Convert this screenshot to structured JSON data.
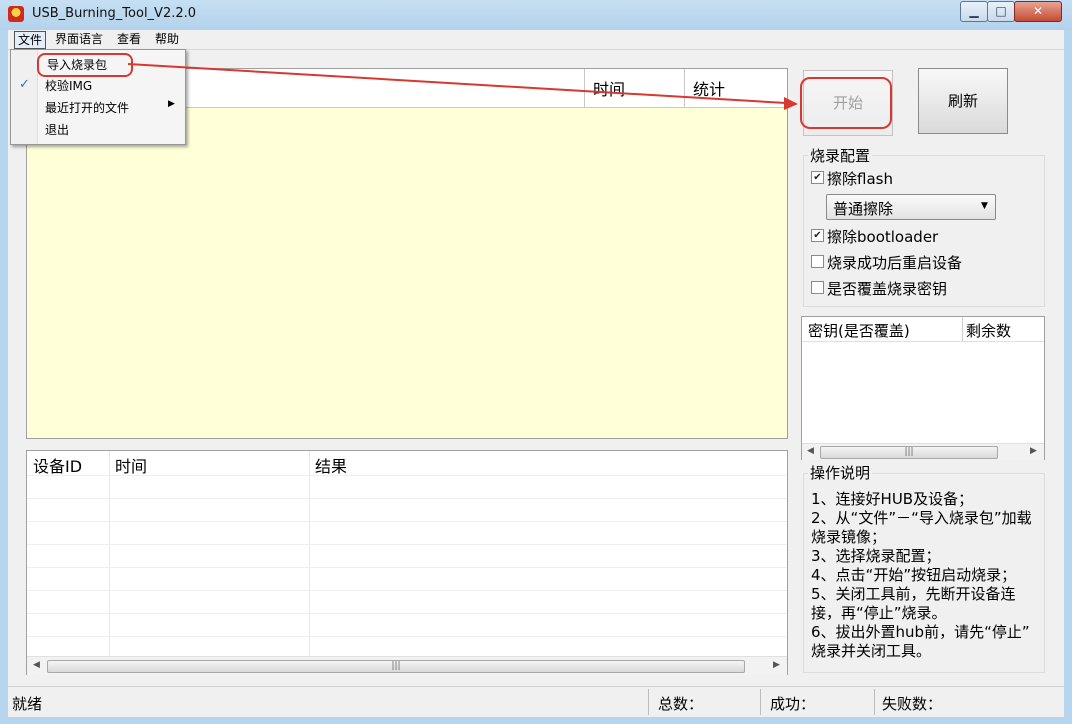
{
  "window": {
    "title": "USB_Burning_Tool_V2.2.0"
  },
  "menubar": {
    "file": "文件",
    "language": "界面语言",
    "view": "查看",
    "help": "帮助"
  },
  "file_menu": {
    "import": "导入烧录包",
    "verify": "校验IMG",
    "recent": "最近打开的文件",
    "exit": "退出"
  },
  "device_list": {
    "col_time": "时间",
    "col_stat": "统计"
  },
  "buttons": {
    "start": "开始",
    "refresh": "刷新"
  },
  "burn_config": {
    "title": "烧录配置",
    "erase_flash": {
      "label": "擦除flash",
      "checked": true
    },
    "erase_mode": "普通擦除",
    "erase_bootloader": {
      "label": "擦除bootloader",
      "checked": true
    },
    "reboot_after": {
      "label": "烧录成功后重启设备",
      "checked": false
    },
    "overwrite_key": {
      "label": "是否覆盖烧录密钥",
      "checked": false
    }
  },
  "key_table": {
    "col_key": "密钥(是否覆盖)",
    "col_remain": "剩余数"
  },
  "instructions": {
    "title": "操作说明",
    "lines": [
      "1、连接好HUB及设备；",
      "2、从“文件”－“导入烧录包”加载",
      "烧录镜像；",
      "3、选择烧录配置；",
      "4、点击“开始”按钮启动烧录；",
      "5、关闭工具前，先断开设备连",
      "接，再“停止”烧录。",
      "6、拔出外置hub前，请先“停止”",
      "烧录并关闭工具。"
    ]
  },
  "result_list": {
    "col_id": "设备ID",
    "col_time": "时间",
    "col_result": "结果"
  },
  "statusbar": {
    "status": "就绪",
    "total": "总数：",
    "success": "成功：",
    "failed": "失败数："
  },
  "colors": {
    "annotation": "#d8382f",
    "list_bg": "#ffffd8",
    "frame": "#b8d5ee"
  }
}
